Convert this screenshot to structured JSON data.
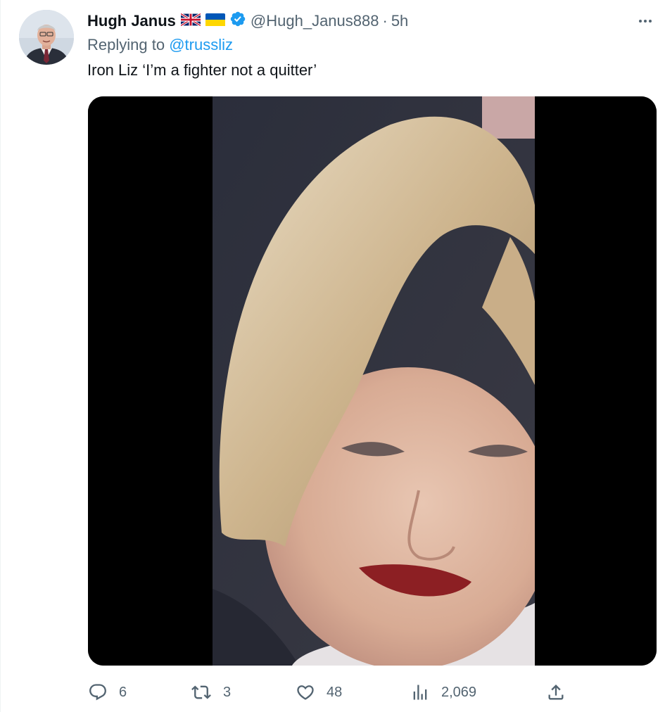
{
  "tweet": {
    "display_name": "Hugh Janus",
    "flags": [
      "uk-flag-icon",
      "ukraine-flag-icon"
    ],
    "handle": "@Hugh_Janus888",
    "separator": "·",
    "time": "5h",
    "reply_prefix": "Replying to",
    "reply_to": "@trussliz",
    "text": "Iron Liz ‘I’m a fighter not a quitter’"
  },
  "actions": {
    "reply_count": "6",
    "retweet_count": "3",
    "like_count": "48",
    "views_count": "2,069"
  },
  "colors": {
    "accent": "#1d9bf0",
    "secondary_text": "#536471",
    "primary_text": "#0f1419",
    "verified": "#1d9bf0"
  },
  "icons": {
    "more": "more-dots-icon",
    "reply": "reply-bubble-icon",
    "retweet": "retweet-icon",
    "like": "heart-icon",
    "views": "views-chart-icon",
    "share": "share-icon"
  }
}
